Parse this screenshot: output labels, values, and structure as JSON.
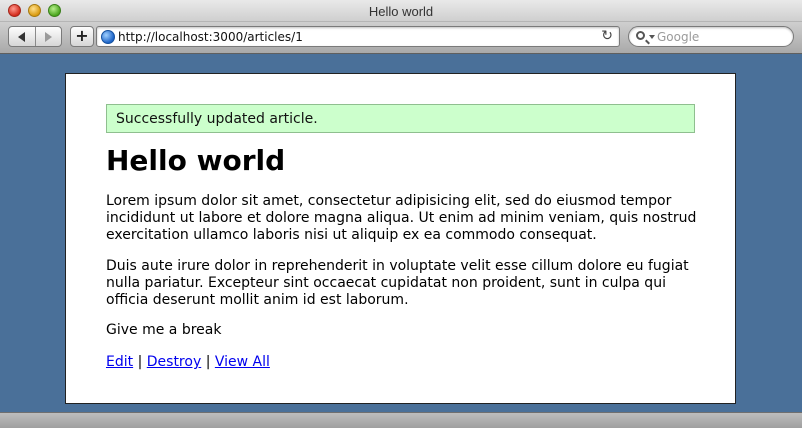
{
  "window": {
    "title": "Hello world"
  },
  "toolbar": {
    "back_icon": "back-arrow-icon",
    "forward_icon": "forward-arrow-icon",
    "add_label": "+",
    "url": "http://localhost:3000/articles/1",
    "reload_glyph": "↻",
    "search_placeholder": "Google"
  },
  "page": {
    "notice": "Successfully updated article.",
    "title": "Hello world",
    "paragraphs": [
      "Lorem ipsum dolor sit amet, consectetur adipisicing elit, sed do eiusmod tempor incididunt ut labore et dolore magna aliqua. Ut enim ad minim veniam, quis nostrud exercitation ullamco laboris nisi ut aliquip ex ea commodo consequat.",
      "Duis aute irure dolor in reprehenderit in voluptate velit esse cillum dolore eu fugiat nulla pariatur. Excepteur sint occaecat cupidatat non proident, sunt in culpa qui officia deserunt mollit anim id est laborum.",
      "Give me a break"
    ],
    "links": {
      "edit": "Edit",
      "destroy": "Destroy",
      "view_all": "View All",
      "separator": "|"
    }
  },
  "colors": {
    "desktop": "#4a7099",
    "notice_bg": "#ccffcc",
    "link": "#0000ee"
  }
}
